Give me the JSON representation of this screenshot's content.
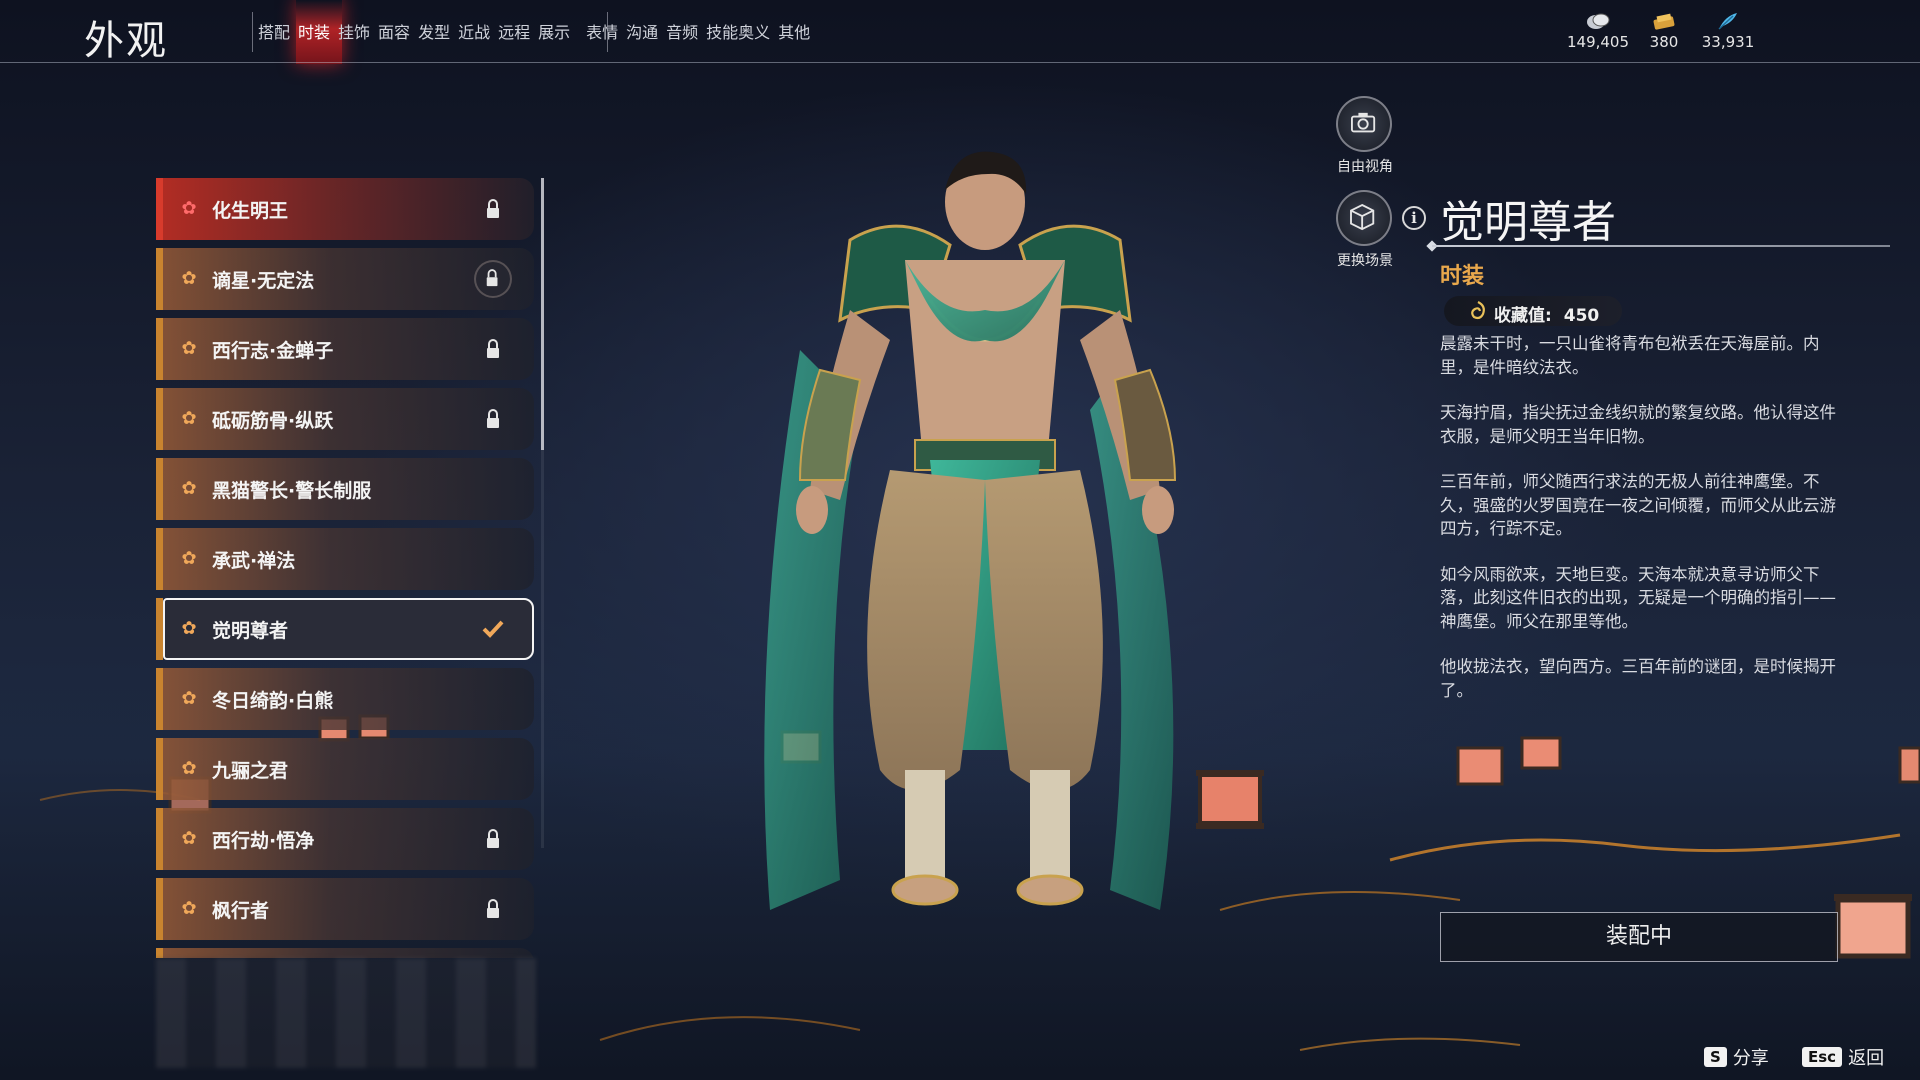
{
  "header": {
    "title": "外观",
    "tabs": [
      "搭配",
      "时装",
      "挂饰",
      "面容",
      "发型",
      "近战",
      "远程",
      "展示",
      "表情",
      "沟通",
      "音频",
      "技能奥义",
      "其他"
    ],
    "active_tab": "时装",
    "currencies": [
      {
        "icon": "coin-icon",
        "value": "149,405"
      },
      {
        "icon": "ticket-icon",
        "value": "380"
      },
      {
        "icon": "feather-icon",
        "value": "33,931"
      }
    ]
  },
  "outfit_list": {
    "items": [
      {
        "label": "化生明王",
        "status": "locked"
      },
      {
        "label": "谪星·无定法",
        "status": "locked-ring"
      },
      {
        "label": "西行志·金蝉子",
        "status": "locked"
      },
      {
        "label": "砥砺筋骨·纵跃",
        "status": "locked"
      },
      {
        "label": "黑猫警长·警长制服",
        "status": "none"
      },
      {
        "label": "承武·禅法",
        "status": "none"
      },
      {
        "label": "觉明尊者",
        "status": "equipped"
      },
      {
        "label": "冬日绮韵·白熊",
        "status": "none"
      },
      {
        "label": "九骊之君",
        "status": "none"
      },
      {
        "label": "西行劫·悟净",
        "status": "locked"
      },
      {
        "label": "枫行者",
        "status": "locked"
      }
    ],
    "selected_index": 6
  },
  "view_controls": {
    "free_camera_label": "自由视角",
    "change_scene_label": "更换场景"
  },
  "detail": {
    "title": "觉明尊者",
    "category": "时装",
    "collect_label": "收藏值:",
    "collect_value": "450",
    "paragraphs": [
      "晨露未干时，一只山雀将青布包袱丢在天海屋前。内里，是件暗纹法衣。",
      "天海拧眉，指尖抚过金线织就的繁复纹路。他认得这件衣服，是师父明王当年旧物。",
      "三百年前，师父随西行求法的无极人前往神鹰堡。不久，强盛的火罗国竟在一夜之间倾覆，而师父从此云游四方，行踪不定。",
      "如今风雨欲来，天地巨变。天海本就决意寻访师父下落，此刻这件旧衣的出现，无疑是一个明确的指引——神鹰堡。师父在那里等他。",
      "他收拢法衣，望向西方。三百年前的谜团，是时候揭开了。"
    ],
    "equip_button": "装配中"
  },
  "hints": [
    {
      "key": "S",
      "label": "分享"
    },
    {
      "key": "Esc",
      "label": "返回"
    }
  ],
  "colors": {
    "active_tab": "#e02a2a",
    "item_stripe": "#c9842f",
    "item_stripe_first": "#d83b2c",
    "category": "#e9a84c"
  }
}
